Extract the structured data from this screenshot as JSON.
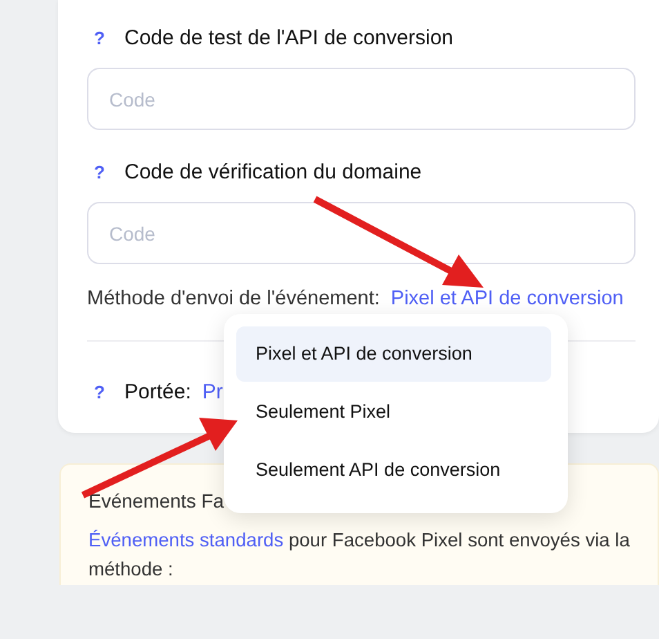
{
  "settings_card": {
    "fields": [
      {
        "label": "Code de test de l'API de conversion",
        "help": "?",
        "placeholder": "Code"
      },
      {
        "label": "Code de vérification du domaine",
        "help": "?",
        "placeholder": "Code"
      }
    ],
    "method": {
      "label": "Méthode d'envoi de l'événement:",
      "value": "Pixel et API de conversion"
    },
    "scope": {
      "help": "?",
      "label": "Portée:",
      "value": "Pr"
    }
  },
  "method_dropdown": [
    {
      "label": "Pixel et API de conversion",
      "selected": true
    },
    {
      "label": "Seulement Pixel",
      "selected": false
    },
    {
      "label": "Seulement API de conversion",
      "selected": false
    }
  ],
  "notice": {
    "title": "Événements Fa",
    "link": "Événements standards",
    "text": "pour Facebook Pixel sont envoyés via la méthode :"
  }
}
